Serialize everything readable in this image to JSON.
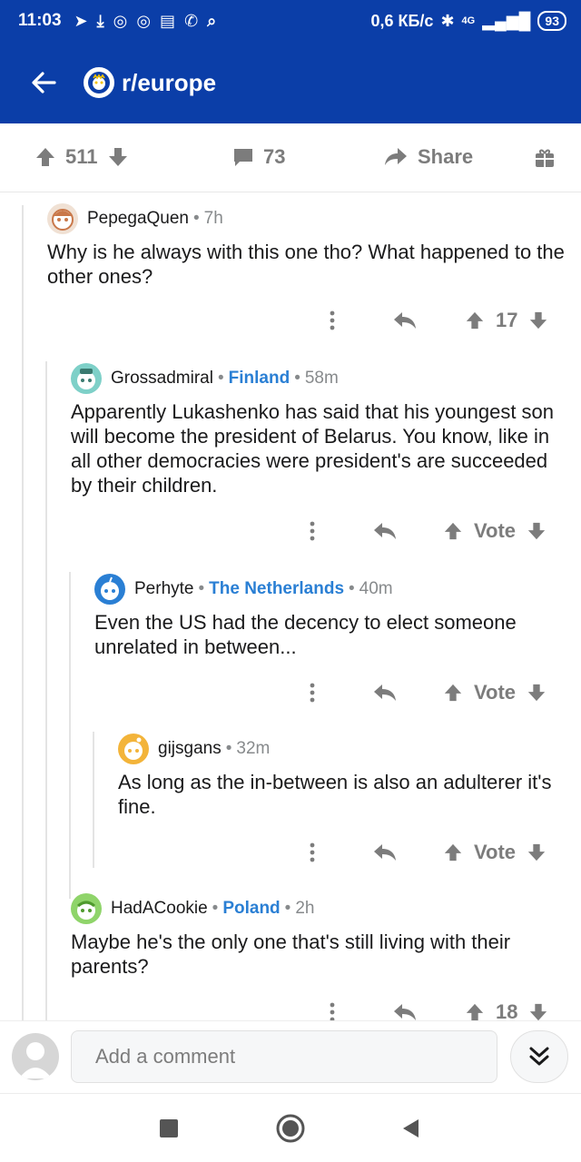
{
  "status": {
    "time": "11:03",
    "speed": "0,6 КБ/с",
    "network": "4G",
    "battery": "93"
  },
  "header": {
    "subreddit": "r/europe"
  },
  "post_bar": {
    "votes": "511",
    "comments": "73",
    "share": "Share"
  },
  "comments": [
    {
      "author": "PepegaQuen",
      "flair": "",
      "age": "7h",
      "body": "Why is he always with this one tho? What happened to the other ones?",
      "score": "17"
    },
    {
      "author": "Grossadmiral",
      "flair": "Finland",
      "age": "58m",
      "body": "Apparently Lukashenko has said that his youngest son will become the president of Belarus. You know, like in all other democracies were president's are succeeded by their children.",
      "score": "Vote"
    },
    {
      "author": "Perhyte",
      "flair": "The Netherlands",
      "age": "40m",
      "body": "Even the US had the decency to elect someone unrelated in between...",
      "score": "Vote"
    },
    {
      "author": "gijsgans",
      "flair": "",
      "age": "32m",
      "body": "As long as the in-between is also an adulterer it's fine.",
      "score": "Vote"
    },
    {
      "author": "HadACookie",
      "flair": "Poland",
      "age": "2h",
      "body": "Maybe he's the only one that's still living with their parents?",
      "score": "18"
    }
  ],
  "composer": {
    "placeholder": "Add a comment"
  },
  "colors": {
    "header_bg": "#0b3ea8",
    "flair": "#2a7fd4",
    "muted": "#7c7c7c"
  }
}
